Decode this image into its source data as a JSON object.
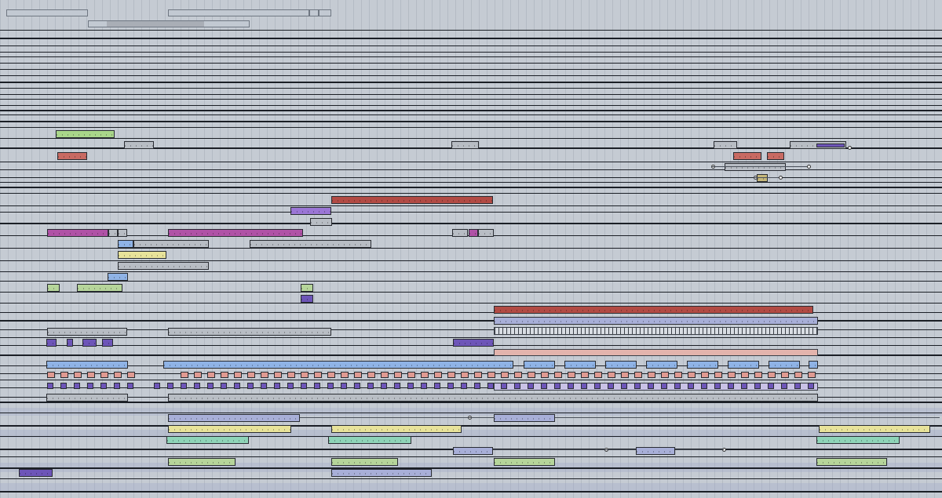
{
  "app": {
    "view": "arrangement-timeline"
  },
  "colors": {
    "background": "#c5cbd3",
    "track_line": "#1b1f26",
    "green": "#a9d68a",
    "red": "#c86a62",
    "grey": "#b8bdc4",
    "purple": "#9b76d6",
    "magenta": "#b052a6",
    "blue": "#8fb3e6",
    "yellow": "#e8e39a",
    "teal": "#8fd4b8",
    "pink": "#e09a92",
    "violet": "#6d55b8",
    "lavender": "#a8afd8"
  },
  "clip_colors": {
    "g": "#a9d68a",
    "r": "#c86a62",
    "gr": "#b8bdc4",
    "p": "#9b76d6",
    "m": "#b052a6",
    "b": "#8fb3e6",
    "y": "#e8e39a",
    "t": "#8fd4b8",
    "pk": "#e09a92",
    "v": "#6d55b8",
    "lv": "#a8afd8",
    "dr": "#b24b45",
    "ol": "#c5b77a",
    "sg": "#b6d59a"
  }
}
